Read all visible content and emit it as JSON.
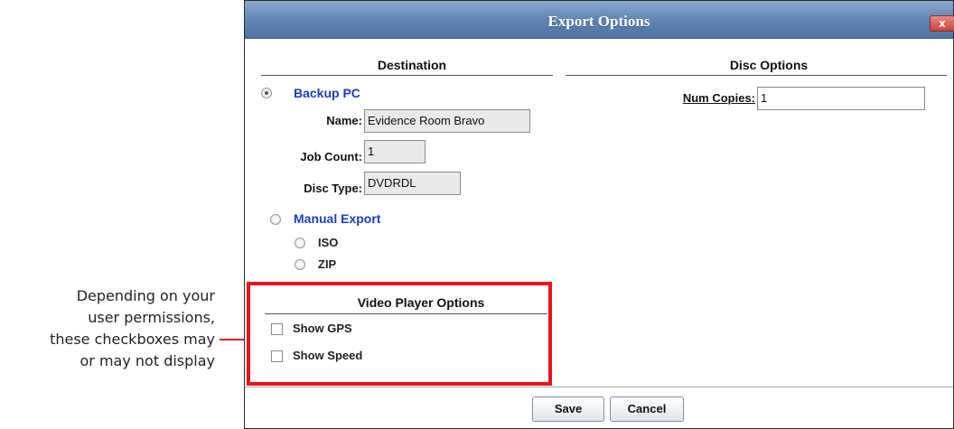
{
  "annotation": {
    "lines": [
      "Depending on your",
      "user permissions,",
      "these checkboxes may",
      "or may not display"
    ]
  },
  "dialog": {
    "title": "Export Options",
    "close_label": "x"
  },
  "destination": {
    "header": "Destination",
    "backup_pc": {
      "label": "Backup PC",
      "selected": true,
      "name_label": "Name:",
      "name_value": "Evidence Room Bravo",
      "job_count_label": "Job Count:",
      "job_count_value": "1",
      "disc_type_label": "Disc Type:",
      "disc_type_value": "DVDRDL"
    },
    "manual_export": {
      "label": "Manual Export",
      "selected": false,
      "iso_label": "ISO",
      "zip_label": "ZIP"
    }
  },
  "disc_options": {
    "header": "Disc Options",
    "num_copies_label": "Num Copies:",
    "num_copies_value": "1"
  },
  "video_player_options": {
    "header": "Video Player Options",
    "show_gps_label": "Show GPS",
    "show_gps_checked": false,
    "show_speed_label": "Show Speed",
    "show_speed_checked": false
  },
  "buttons": {
    "save": "Save",
    "cancel": "Cancel"
  },
  "colors": {
    "highlight": "#e8141b",
    "titlebar": "#5f82b2",
    "link_blue": "#1a3dbf"
  }
}
